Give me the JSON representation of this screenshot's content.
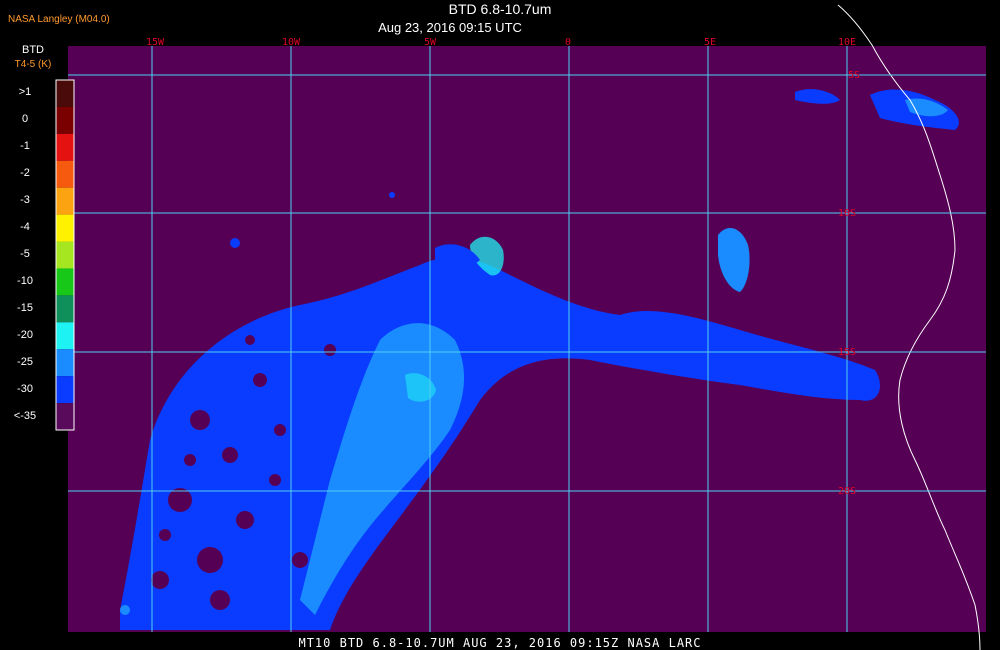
{
  "credit": "NASA Langley (M04.0)",
  "title": "BTD 6.8-10.7um",
  "subtitle": "Aug 23, 2016 09:15 UTC",
  "legend": {
    "title": "BTD",
    "subtitle": "T4-5 (K)",
    "items": [
      {
        "label": ">1",
        "color": "#4a0a0a"
      },
      {
        "label": "0",
        "color": "#7a0000"
      },
      {
        "label": "-1",
        "color": "#e51212"
      },
      {
        "label": "-2",
        "color": "#f55a0e"
      },
      {
        "label": "-3",
        "color": "#fba310"
      },
      {
        "label": "-4",
        "color": "#fff200"
      },
      {
        "label": "-5",
        "color": "#a6e620"
      },
      {
        "label": "-10",
        "color": "#18c818"
      },
      {
        "label": "-15",
        "color": "#0f8f5a"
      },
      {
        "label": "-20",
        "color": "#1ff2f2"
      },
      {
        "label": "-25",
        "color": "#1a8cff"
      },
      {
        "label": "-30",
        "color": "#0a3cff"
      },
      {
        "label": "<-35",
        "color": "#5a0a5a"
      }
    ]
  },
  "grid": {
    "longitudes": [
      "15W",
      "10W",
      "5W",
      "0",
      "5E",
      "10E"
    ],
    "latitudes": [
      "5S",
      "10S",
      "15S",
      "20S"
    ]
  },
  "footer": "MT10  BTD 6.8-10.7UM  AUG 23, 2016 09:15Z  NASA LARC",
  "colors": {
    "background": "#550055",
    "gridline": "#4fd0f0",
    "coastline": "#ffffff",
    "gridlabel": "#e0002a",
    "credit": "#ff9a2e"
  }
}
